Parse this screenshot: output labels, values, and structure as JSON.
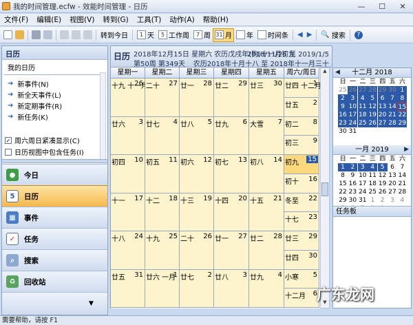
{
  "window": {
    "title": "我的时间管理.ecfw - 效能时间管理 - 日历"
  },
  "menu": [
    "文件(F)",
    "编辑(E)",
    "视图(V)",
    "转到(G)",
    "工具(T)",
    "动作(A)",
    "帮助(H)"
  ],
  "toolbar": {
    "goto_today": "转到今日",
    "day": "天",
    "workweek": "工作周",
    "week": "周",
    "month": "月",
    "year": "年",
    "timebar": "时间条",
    "search": "搜索",
    "day_num": "1",
    "workweek_num": "5",
    "week_num": "7",
    "month_num": "31"
  },
  "left": {
    "header": "日历",
    "sub": "我的日历",
    "links": [
      "新事件(N)",
      "新全天事件(L)",
      "新定期事件(R)",
      "新任务(K)"
    ],
    "checks": [
      {
        "label": "周六周日紧凑显示(C)",
        "checked": true
      },
      {
        "label": "日历视图中包含任务(I)",
        "checked": false
      }
    ],
    "nav": [
      "今日",
      "日历",
      "事件",
      "任务",
      "搜索",
      "回收站"
    ]
  },
  "calendar": {
    "title": "日历",
    "line1": "2018年12月15日 星期六 农历戊戌年(狗)十一月初九",
    "line2": "第50周 第349天",
    "range": "2018/11/25 至 2019/1/5",
    "lunar_range": "农历2018年十月十八 至 2018年十一月三十",
    "days": [
      "星期一",
      "星期二",
      "星期三",
      "星期四",
      "星期五",
      "周六/周日"
    ],
    "weeks": [
      [
        {
          "l": "十九 十一月",
          "n": "26"
        },
        {
          "l": "二十",
          "n": "27"
        },
        {
          "l": "廿一",
          "n": "28"
        },
        {
          "l": "廿二",
          "n": "29"
        },
        {
          "l": "廿三",
          "n": "30"
        },
        {
          "l": "廿四 十二月",
          "n": "1"
        },
        {
          "l": "廿五",
          "n": "2"
        }
      ],
      [
        {
          "l": "廿六",
          "n": "3"
        },
        {
          "l": "廿七",
          "n": "4"
        },
        {
          "l": "廿八",
          "n": "5"
        },
        {
          "l": "廿九",
          "n": "6"
        },
        {
          "l": "大雪",
          "n": "7"
        },
        {
          "l": "初二",
          "n": "8"
        },
        {
          "l": "初三",
          "n": "9"
        }
      ],
      [
        {
          "l": "初四",
          "n": "10"
        },
        {
          "l": "初五",
          "n": "11"
        },
        {
          "l": "初六",
          "n": "12"
        },
        {
          "l": "初七",
          "n": "13"
        },
        {
          "l": "初八",
          "n": "14"
        },
        {
          "l": "初九",
          "n": "15"
        },
        {
          "l": "初十",
          "n": "16"
        }
      ],
      [
        {
          "l": "十一",
          "n": "17"
        },
        {
          "l": "十二",
          "n": "18"
        },
        {
          "l": "十三",
          "n": "19"
        },
        {
          "l": "十四",
          "n": "20"
        },
        {
          "l": "十五",
          "n": "21"
        },
        {
          "l": "冬至",
          "n": "22"
        },
        {
          "l": "十七",
          "n": "23"
        }
      ],
      [
        {
          "l": "十八",
          "n": "24"
        },
        {
          "l": "十九",
          "n": "25"
        },
        {
          "l": "二十",
          "n": "26"
        },
        {
          "l": "廿一",
          "n": "27"
        },
        {
          "l": "廿二",
          "n": "28"
        },
        {
          "l": "廿三",
          "n": "29"
        },
        {
          "l": "廿四",
          "n": "30"
        }
      ],
      [
        {
          "l": "廿五",
          "n": "31"
        },
        {
          "l": "廿六 一月",
          "n": "1"
        },
        {
          "l": "廿七",
          "n": "2"
        },
        {
          "l": "廿八",
          "n": "3"
        },
        {
          "l": "廿九",
          "n": "4"
        },
        {
          "l": "小寒",
          "n": "5"
        },
        {
          "l": "十二月",
          "n": "6"
        }
      ]
    ]
  },
  "minical": {
    "dec": {
      "title": "十二月 2018",
      "dow": [
        "日",
        "一",
        "二",
        "三",
        "四",
        "五",
        "六"
      ],
      "days": [
        "25",
        "26",
        "27",
        "28",
        "29",
        "30",
        "1",
        "2",
        "3",
        "4",
        "5",
        "6",
        "7",
        "8",
        "9",
        "10",
        "11",
        "12",
        "13",
        "14",
        "15",
        "16",
        "17",
        "18",
        "19",
        "20",
        "21",
        "22",
        "23",
        "24",
        "25",
        "26",
        "27",
        "28",
        "29",
        "30",
        "31"
      ]
    },
    "jan": {
      "title": "一月 2019",
      "dow": [
        "日",
        "一",
        "二",
        "三",
        "四",
        "五",
        "六"
      ],
      "days": [
        "1",
        "2",
        "3",
        "4",
        "5",
        "6",
        "7",
        "8",
        "9",
        "10",
        "11",
        "12",
        "13",
        "14",
        "15",
        "16",
        "17",
        "18",
        "19",
        "20",
        "21",
        "22",
        "23",
        "24",
        "25",
        "26",
        "27",
        "28",
        "29",
        "30",
        "31",
        "1",
        "2",
        "3",
        "4",
        "5",
        "6",
        "7",
        "8",
        "9"
      ]
    }
  },
  "taskboard": "任务板",
  "status": "需要帮助，请按 F1",
  "watermark": "广东龙网"
}
